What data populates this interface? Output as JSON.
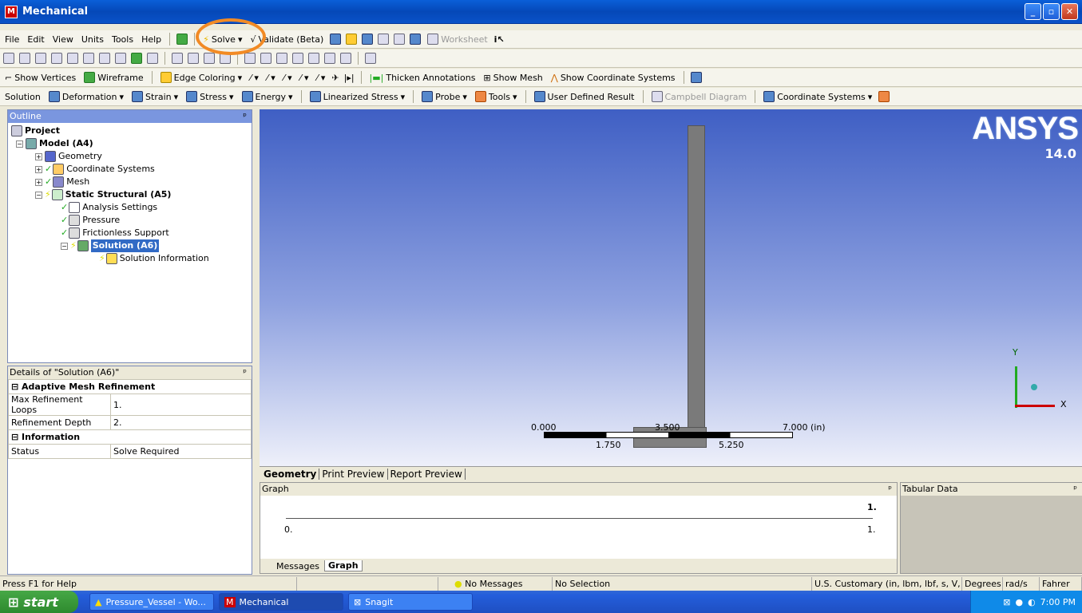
{
  "window": {
    "title": "Mechanical",
    "app_letter": "M"
  },
  "menubar": {
    "items": [
      "File",
      "Edit",
      "View",
      "Units",
      "Tools",
      "Help"
    ],
    "solve": "Solve",
    "validate": "Validate (Beta)",
    "worksheet": "Worksheet"
  },
  "toolbar3": {
    "show_vertices": "Show Vertices",
    "wireframe": "Wireframe",
    "edge_coloring": "Edge Coloring",
    "thicken": "Thicken Annotations",
    "show_mesh": "Show Mesh",
    "show_cs": "Show Coordinate Systems"
  },
  "toolbar4": {
    "solution": "Solution",
    "deformation": "Deformation",
    "strain": "Strain",
    "stress": "Stress",
    "energy": "Energy",
    "linearized": "Linearized Stress",
    "probe": "Probe",
    "tools": "Tools",
    "udr": "User Defined Result",
    "campbell": "Campbell Diagram",
    "cs": "Coordinate Systems"
  },
  "outline": {
    "title": "Outline",
    "project": "Project",
    "model": "Model (A4)",
    "geometry": "Geometry",
    "cs": "Coordinate Systems",
    "mesh": "Mesh",
    "static": "Static Structural (A5)",
    "analysis": "Analysis Settings",
    "pressure": "Pressure",
    "frictionless": "Frictionless Support",
    "solution": "Solution (A6)",
    "solinfo": "Solution Information"
  },
  "details": {
    "title": "Details of \"Solution (A6)\"",
    "group1": "Adaptive Mesh Refinement",
    "r1k": "Max Refinement Loops",
    "r1v": "1.",
    "r2k": "Refinement Depth",
    "r2v": "2.",
    "group2": "Information",
    "r3k": "Status",
    "r3v": "Solve Required"
  },
  "viewport": {
    "logo": "ANSYS",
    "version": "14.0",
    "s0": "0.000",
    "s1": "1.750",
    "s2": "3.500",
    "s3": "5.250",
    "s4": "7.000 (in)",
    "axis_y": "Y",
    "axis_x": "X"
  },
  "viewtabs": [
    "Geometry",
    "Print Preview",
    "Report Preview"
  ],
  "graph": {
    "title": "Graph",
    "top_val": "1.",
    "x0": "0.",
    "x1": "1.",
    "tab_messages": "Messages",
    "tab_graph": "Graph"
  },
  "tabular": {
    "title": "Tabular Data"
  },
  "status": {
    "help": "Press F1 for Help",
    "messages": "No Messages",
    "selection": "No Selection",
    "units": "U.S. Customary (in, lbm, lbf, s, V, A)",
    "degrees": "Degrees",
    "rads": "rad/s",
    "temp": "Fahrer"
  },
  "taskbar": {
    "start": "start",
    "t1": "Pressure_Vessel - Wo...",
    "t2": "Mechanical",
    "t3": "Snagit",
    "clock": "7:00 PM"
  }
}
